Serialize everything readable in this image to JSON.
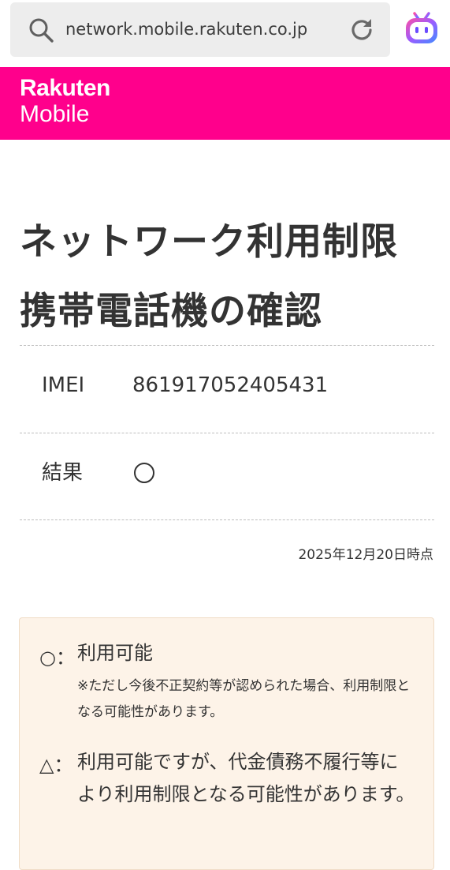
{
  "browser": {
    "url": "network.mobile.rakuten.co.jp"
  },
  "brand": {
    "line1": "Rakuten",
    "line2": "Mobile",
    "color": "#ff008c"
  },
  "page": {
    "title": "ネットワーク利用制限携帯電話機の確認"
  },
  "result": {
    "rows": [
      {
        "label": "IMEI",
        "value": "861917052405431"
      },
      {
        "label": "結果",
        "value": "○"
      }
    ],
    "timestamp": "2025年12月20日時点"
  },
  "legend": {
    "items": [
      {
        "symbol": "○",
        "separator": "：",
        "label": "利用可能",
        "note": "※ただし今後不正契約等が認められた場合、利用制限となる可能性があります。"
      },
      {
        "symbol": "△",
        "separator": "：",
        "label": "利用可能ですが、代金債務不履行等により利用制限となる可能性があります。"
      }
    ],
    "background": "#fdf3e8"
  },
  "icons": {
    "search": "search-icon",
    "reload": "reload-icon",
    "assistant": "assistant-icon"
  }
}
